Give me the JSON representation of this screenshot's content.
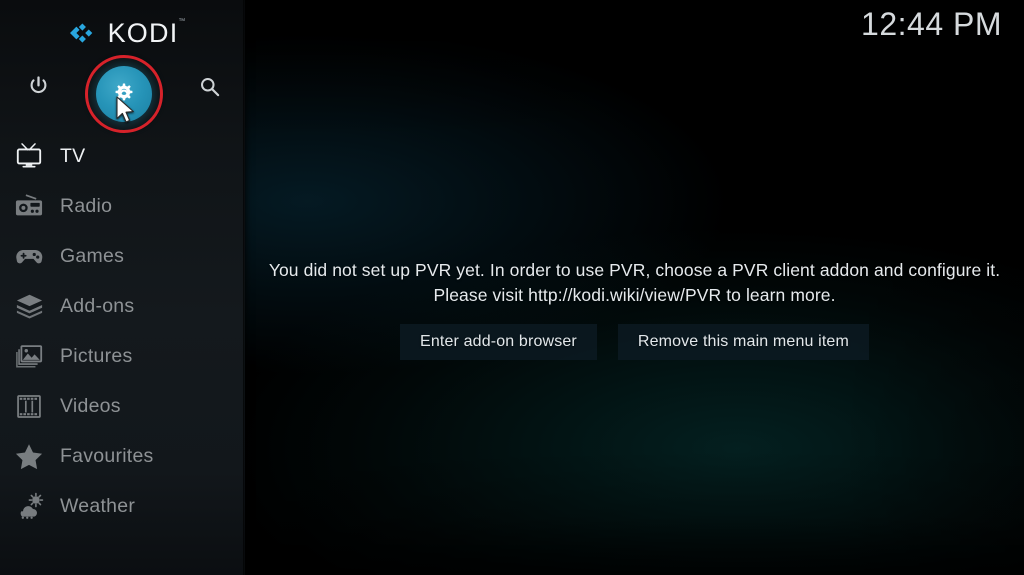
{
  "app": {
    "logo_text": "KODI",
    "logo_tm": "™"
  },
  "clock": "12:44 PM",
  "top_icons": [
    {
      "name": "power-icon",
      "label": "Power"
    },
    {
      "name": "settings-icon",
      "label": "Settings"
    },
    {
      "name": "search-icon",
      "label": "Search"
    }
  ],
  "sidebar": {
    "items": [
      {
        "label": "TV",
        "icon": "tv-icon",
        "selected": true
      },
      {
        "label": "Radio",
        "icon": "radio-icon",
        "selected": false
      },
      {
        "label": "Games",
        "icon": "gamepad-icon",
        "selected": false
      },
      {
        "label": "Add-ons",
        "icon": "addons-box-icon",
        "selected": false
      },
      {
        "label": "Pictures",
        "icon": "pictures-icon",
        "selected": false
      },
      {
        "label": "Videos",
        "icon": "film-strip-icon",
        "selected": false
      },
      {
        "label": "Favourites",
        "icon": "star-icon",
        "selected": false
      },
      {
        "label": "Weather",
        "icon": "weather-icon",
        "selected": false
      }
    ]
  },
  "main": {
    "message_line1": "You did not set up PVR yet. In order to use PVR, choose a PVR client addon and configure it.",
    "message_line2": "Please visit http://kodi.wiki/view/PVR to learn more.",
    "buttons": [
      {
        "label": "Enter add-on browser"
      },
      {
        "label": "Remove this main menu item"
      }
    ]
  },
  "annotation": {
    "highlight_color": "#d6222a",
    "highlight_target": "settings-icon",
    "cursor_visible": true
  },
  "colors": {
    "accent": "#2694b8",
    "sidebar_bg": "#14191d",
    "background_teal": "#0d4d63",
    "text_primary": "#eef1f3",
    "text_muted": "#8e9295"
  }
}
